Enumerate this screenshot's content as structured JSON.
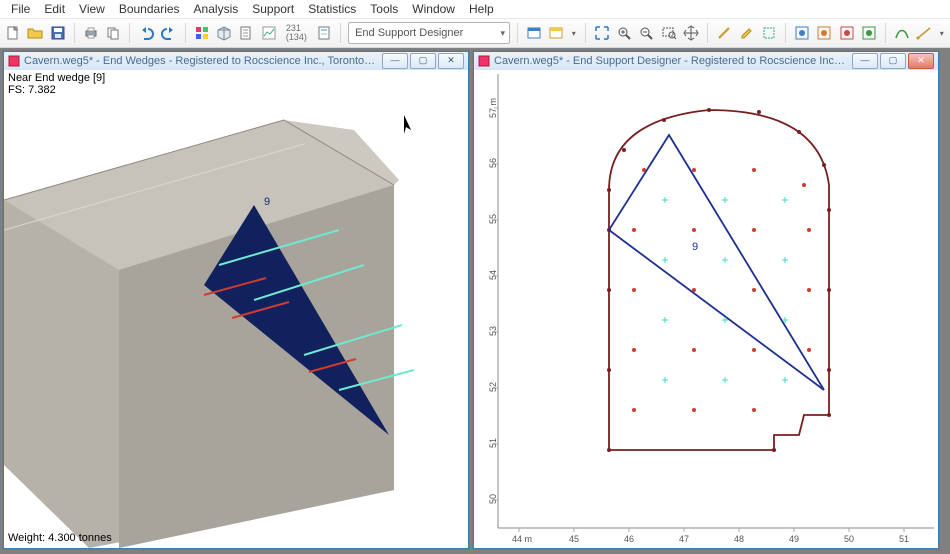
{
  "menu": {
    "items": [
      "File",
      "Edit",
      "View",
      "Boundaries",
      "Analysis",
      "Support",
      "Statistics",
      "Tools",
      "Window",
      "Help"
    ]
  },
  "toolbar": {
    "combo_label": "End Support Designer",
    "stat_top": "231",
    "stat_bottom": "(134)"
  },
  "windows": {
    "left": {
      "title": "Cavern.weg5* - End Wedges - Registered to Rocscience Inc., Toronto Office",
      "line1": "Near End wedge [9]",
      "line2": "FS: 7.382",
      "footer": "Weight: 4.300 tonnes",
      "wedge_label": "9"
    },
    "right": {
      "title": "Cavern.weg5* - End Support Designer - Registered to Rocscience Inc., Toronto Office",
      "wedge_label": "9",
      "x_ticks": [
        "44 m",
        "45",
        "46",
        "47",
        "48",
        "49",
        "50",
        "51"
      ],
      "y_ticks": [
        "50",
        "51",
        "52",
        "53",
        "54",
        "55",
        "56",
        "57 m"
      ]
    }
  }
}
